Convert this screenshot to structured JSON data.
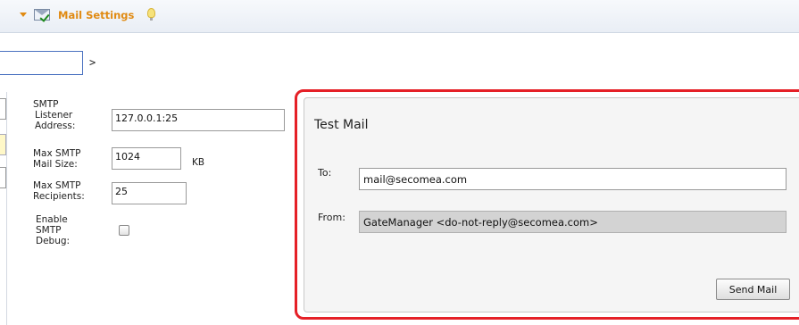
{
  "header": {
    "title": "Mail Settings"
  },
  "top_field": {
    "value": "",
    "caret": ">"
  },
  "smtp": {
    "listener_label_1": "SMTP",
    "listener_label_2": "Listener",
    "listener_label_3": "Address:",
    "listener_value": "127.0.0.1:25",
    "max_size_label_1": "Max SMTP",
    "max_size_label_2": "Mail Size:",
    "max_size_value": "1024",
    "max_size_unit": "KB",
    "max_recipients_label_1": "Max SMTP",
    "max_recipients_label_2": "Recipients:",
    "max_recipients_value": "25",
    "debug_label_1": "Enable",
    "debug_label_2": "SMTP",
    "debug_label_3": "Debug:",
    "debug_checked": false
  },
  "test_mail": {
    "title": "Test Mail",
    "to_label": "To:",
    "to_value": "mail@secomea.com",
    "from_label": "From:",
    "from_value": "GateManager <do-not-reply@secomea.com>",
    "send_button": "Send Mail"
  },
  "colors": {
    "header_title": "#e08a12",
    "highlight_border": "#e52027",
    "input_focus_border": "#4a72c0",
    "disabled_field": "#d3d3d3"
  },
  "icons": [
    "collapse-arrow-icon",
    "mail-settings-icon",
    "lightbulb-icon"
  ]
}
